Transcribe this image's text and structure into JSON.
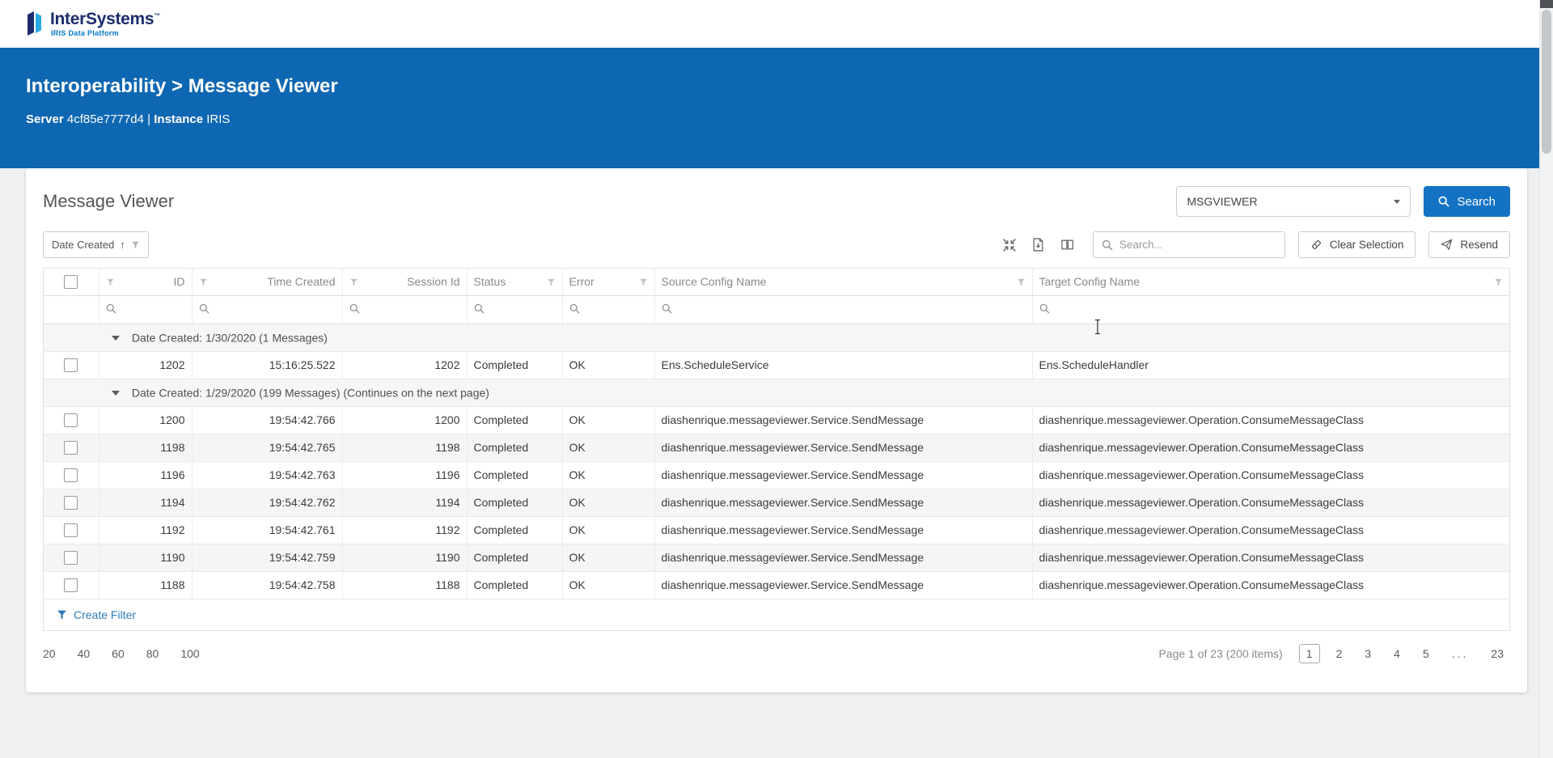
{
  "brand": {
    "name": "InterSystems",
    "trademark": "™",
    "tagline": "IRIS Data Platform"
  },
  "hero": {
    "breadcrumb": "Interoperability > Message Viewer",
    "server_label": "Server",
    "server_value": "4cf85e7777d4",
    "divider": "|",
    "instance_label": "Instance",
    "instance_value": "IRIS"
  },
  "panel": {
    "title": "Message Viewer",
    "viewer_dropdown_value": "MSGVIEWER",
    "search_button_label": "Search"
  },
  "toolbar": {
    "sort_field": "Date Created",
    "sort_direction_arrow": "↑",
    "search_placeholder": "Search...",
    "clear_selection_label": "Clear Selection",
    "resend_label": "Resend"
  },
  "icons": {
    "search": "magnifier",
    "filter": "funnel",
    "collapse": "collapse-arrows",
    "export": "file-export",
    "column_chooser": "column-chooser",
    "clear": "eraser",
    "resend": "paper-plane",
    "dropdown": "caret-down",
    "group_toggle": "triangle-down"
  },
  "grid": {
    "columns": [
      "ID",
      "Time Created",
      "Session Id",
      "Status",
      "Error",
      "Source Config Name",
      "Target Config Name"
    ],
    "groups": [
      {
        "label": "Date Created: 1/30/2020 (1 Messages)",
        "rows": [
          {
            "id": "1202",
            "time_created": "15:16:25.522",
            "session_id": "1202",
            "status": "Completed",
            "error": "OK",
            "source": "Ens.ScheduleService",
            "target": "Ens.ScheduleHandler"
          }
        ]
      },
      {
        "label": "Date Created: 1/29/2020 (199 Messages) (Continues on the next page)",
        "rows": [
          {
            "id": "1200",
            "time_created": "19:54:42.766",
            "session_id": "1200",
            "status": "Completed",
            "error": "OK",
            "source": "diashenrique.messageviewer.Service.SendMessage",
            "target": "diashenrique.messageviewer.Operation.ConsumeMessageClass"
          },
          {
            "id": "1198",
            "time_created": "19:54:42.765",
            "session_id": "1198",
            "status": "Completed",
            "error": "OK",
            "source": "diashenrique.messageviewer.Service.SendMessage",
            "target": "diashenrique.messageviewer.Operation.ConsumeMessageClass"
          },
          {
            "id": "1196",
            "time_created": "19:54:42.763",
            "session_id": "1196",
            "status": "Completed",
            "error": "OK",
            "source": "diashenrique.messageviewer.Service.SendMessage",
            "target": "diashenrique.messageviewer.Operation.ConsumeMessageClass"
          },
          {
            "id": "1194",
            "time_created": "19:54:42.762",
            "session_id": "1194",
            "status": "Completed",
            "error": "OK",
            "source": "diashenrique.messageviewer.Service.SendMessage",
            "target": "diashenrique.messageviewer.Operation.ConsumeMessageClass"
          },
          {
            "id": "1192",
            "time_created": "19:54:42.761",
            "session_id": "1192",
            "status": "Completed",
            "error": "OK",
            "source": "diashenrique.messageviewer.Service.SendMessage",
            "target": "diashenrique.messageviewer.Operation.ConsumeMessageClass"
          },
          {
            "id": "1190",
            "time_created": "19:54:42.759",
            "session_id": "1190",
            "status": "Completed",
            "error": "OK",
            "source": "diashenrique.messageviewer.Service.SendMessage",
            "target": "diashenrique.messageviewer.Operation.ConsumeMessageClass"
          },
          {
            "id": "1188",
            "time_created": "19:54:42.758",
            "session_id": "1188",
            "status": "Completed",
            "error": "OK",
            "source": "diashenrique.messageviewer.Service.SendMessage",
            "target": "diashenrique.messageviewer.Operation.ConsumeMessageClass"
          }
        ]
      }
    ]
  },
  "footer": {
    "create_filter_label": "Create Filter",
    "page_sizes": [
      "20",
      "40",
      "60",
      "80",
      "100"
    ],
    "summary": "Page 1 of 23 (200 items)",
    "pages": [
      "1",
      "2",
      "3",
      "4",
      "5",
      "...",
      "23"
    ],
    "current_page": "1"
  },
  "colors": {
    "hero_blue": "#0e67b2",
    "button_blue": "#1372c4",
    "link_blue": "#2e7cb8",
    "brand_navy": "#1c2d6e",
    "brand_cyan": "#0077c8"
  }
}
